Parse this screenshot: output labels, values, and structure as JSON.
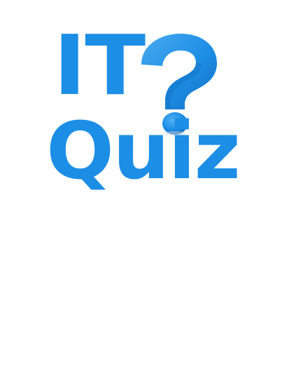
{
  "logo": {
    "line1": "IT",
    "line2": "Quiz",
    "icon": "question-mark-icon",
    "colors": {
      "primary": "#1d8ee6",
      "shade": "#1478c8",
      "highlight": "#5ab4f2"
    }
  }
}
